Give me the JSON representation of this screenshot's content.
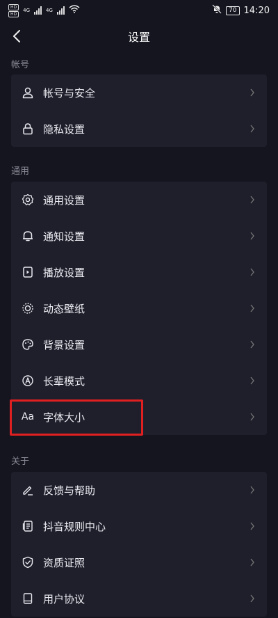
{
  "status_bar": {
    "sim1": "HD",
    "sim2": "HD",
    "net1": "4G",
    "net2": "4G",
    "battery": "70",
    "time": "14:20"
  },
  "header": {
    "title": "设置"
  },
  "sections": {
    "account": {
      "label": "帐号",
      "items": [
        {
          "label": "帐号与安全",
          "icon": "user-icon"
        },
        {
          "label": "隐私设置",
          "icon": "lock-icon"
        }
      ]
    },
    "general": {
      "label": "通用",
      "items": [
        {
          "label": "通用设置",
          "icon": "gear-icon"
        },
        {
          "label": "通知设置",
          "icon": "bell-icon"
        },
        {
          "label": "播放设置",
          "icon": "play-icon"
        },
        {
          "label": "动态壁纸",
          "icon": "wallpaper-icon"
        },
        {
          "label": "背景设置",
          "icon": "palette-icon"
        },
        {
          "label": "长辈模式",
          "icon": "elder-mode-icon"
        },
        {
          "label": "字体大小",
          "icon": "font-size-icon",
          "icon_text": "Aa"
        }
      ]
    },
    "about": {
      "label": "关于",
      "items": [
        {
          "label": "反馈与帮助",
          "icon": "edit-icon"
        },
        {
          "label": "抖音规则中心",
          "icon": "document-icon"
        },
        {
          "label": "资质证照",
          "icon": "shield-check-icon"
        },
        {
          "label": "用户协议",
          "icon": "book-icon"
        }
      ]
    }
  },
  "colors": {
    "background": "#151520",
    "card": "#1f1f2c",
    "highlight": "#e02020",
    "section_label": "#8a8a96"
  }
}
